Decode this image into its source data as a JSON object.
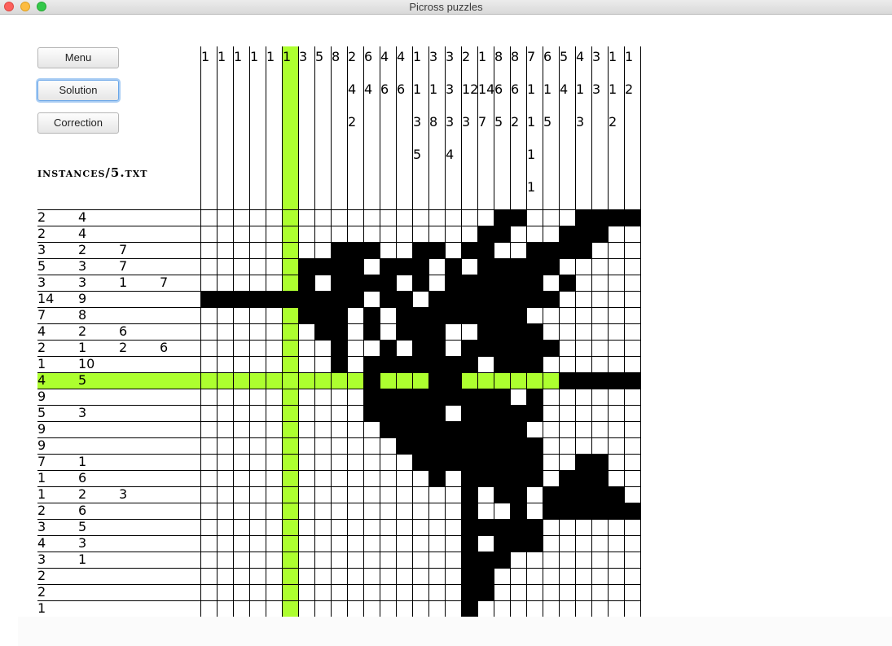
{
  "window": {
    "title": "Picross puzzles"
  },
  "buttons": {
    "menu": "Menu",
    "solution": "Solution",
    "correction": "Correction"
  },
  "file": {
    "name": "instances/5.txt"
  },
  "colors": {
    "highlight": "#adff2f",
    "filled": "#000000"
  },
  "highlight": {
    "row": 10,
    "col": 5
  },
  "column_clues": [
    [
      "1"
    ],
    [
      "1"
    ],
    [
      "1"
    ],
    [
      "1"
    ],
    [
      "1"
    ],
    [
      "1"
    ],
    [
      "3"
    ],
    [
      "5"
    ],
    [
      "8"
    ],
    [
      "2",
      "4",
      "2"
    ],
    [
      "6",
      "4"
    ],
    [
      "4",
      "6"
    ],
    [
      "4",
      "6"
    ],
    [
      "1",
      "1",
      "3",
      "5"
    ],
    [
      "3",
      "1",
      "8"
    ],
    [
      "3",
      "3",
      "3",
      "4"
    ],
    [
      "2",
      "12",
      "3"
    ],
    [
      "1",
      "14",
      "7"
    ],
    [
      "8",
      "6",
      "5"
    ],
    [
      "8",
      "6",
      "2"
    ],
    [
      "7",
      "1",
      "1",
      "1",
      "1"
    ],
    [
      "6",
      "1",
      "5"
    ],
    [
      "5",
      "4"
    ],
    [
      "4",
      "1",
      "3"
    ],
    [
      "3",
      "3"
    ],
    [
      "1",
      "1",
      "2"
    ],
    [
      "1",
      "2"
    ]
  ],
  "row_clues": [
    [
      "2",
      "4"
    ],
    [
      "2",
      "4"
    ],
    [
      "3",
      "2",
      "7"
    ],
    [
      "5",
      "3",
      "7"
    ],
    [
      "3",
      "3",
      "1",
      "7"
    ],
    [
      "14",
      "9"
    ],
    [
      "7",
      "8"
    ],
    [
      "4",
      "2",
      "6"
    ],
    [
      "2",
      "1",
      "2",
      "6"
    ],
    [
      "1",
      "10"
    ],
    [
      "4",
      "5"
    ],
    [
      "9"
    ],
    [
      "5",
      "3"
    ],
    [
      "9"
    ],
    [
      "9"
    ],
    [
      "7",
      "1"
    ],
    [
      "1",
      "6"
    ],
    [
      "1",
      "2",
      "3"
    ],
    [
      "2",
      "6"
    ],
    [
      "3",
      "5"
    ],
    [
      "4",
      "3"
    ],
    [
      "3",
      "1"
    ],
    [
      "2"
    ],
    [
      "2"
    ],
    [
      "1"
    ]
  ],
  "grid": [
    "..................##...####",
    ".................##...###..",
    "........###..##.##..####...",
    "......####.###.#.#####.....",
    "......#.####.#.######.#....",
    "##########.##.########.....",
    "......###.#.########.......",
    ".......##.#.###..####......",
    "........#..#.##.######.....",
    "........#.#######.###......",
    "..........#...##......#####",
    "..........#########.#......",
    "..........#####.#####......",
    "...........#########.......",
    "............#########......",
    ".............########..##..",
    "..............#.#####.###..",
    "................#.##.#####.",
    "................#..#.######",
    "................#####......",
    "................#.###......",
    "................###........",
    "................##.........",
    "................##.........",
    "................#.........."
  ]
}
